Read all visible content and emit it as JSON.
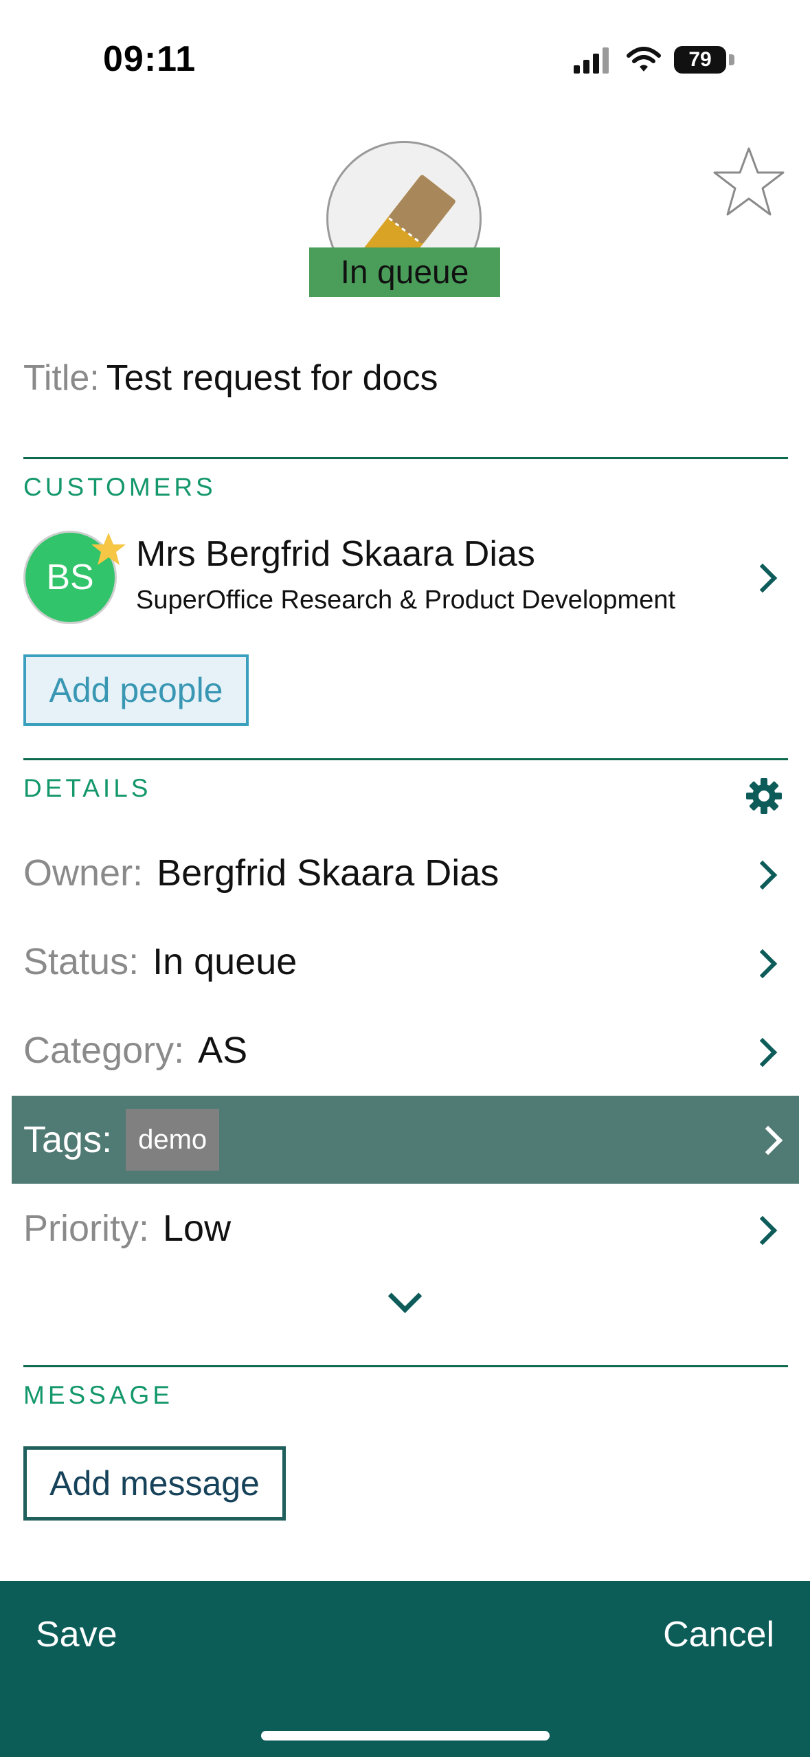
{
  "status_bar": {
    "time": "09:11",
    "battery": "79"
  },
  "hero": {
    "status_badge": "In queue",
    "favorite_icon": "star-outline-icon",
    "ticket_icon": "ticket-icon"
  },
  "title": {
    "label": "Title:",
    "value": "Test request for docs"
  },
  "customers": {
    "section": "CUSTOMERS",
    "person": {
      "initials": "BS",
      "name": "Mrs Bergfrid Skaara Dias",
      "company": "SuperOffice Research & Product Development"
    },
    "add_people": "Add people"
  },
  "details": {
    "section": "DETAILS",
    "owner": {
      "label": "Owner:",
      "value": "Bergfrid Skaara Dias"
    },
    "status": {
      "label": "Status:",
      "value": "In queue"
    },
    "category": {
      "label": "Category:",
      "value": "AS"
    },
    "tags": {
      "label": "Tags:",
      "value": "demo"
    },
    "priority": {
      "label": "Priority:",
      "value": "Low"
    }
  },
  "message": {
    "section": "MESSAGE",
    "add_message": "Add message"
  },
  "footer": {
    "save": "Save",
    "cancel": "Cancel"
  },
  "colors": {
    "accent": "#13976b",
    "footer": "#0c5c58",
    "status_badge": "#4a9e5a",
    "selected_row": "#507a74",
    "avatar": "#32c46a"
  }
}
